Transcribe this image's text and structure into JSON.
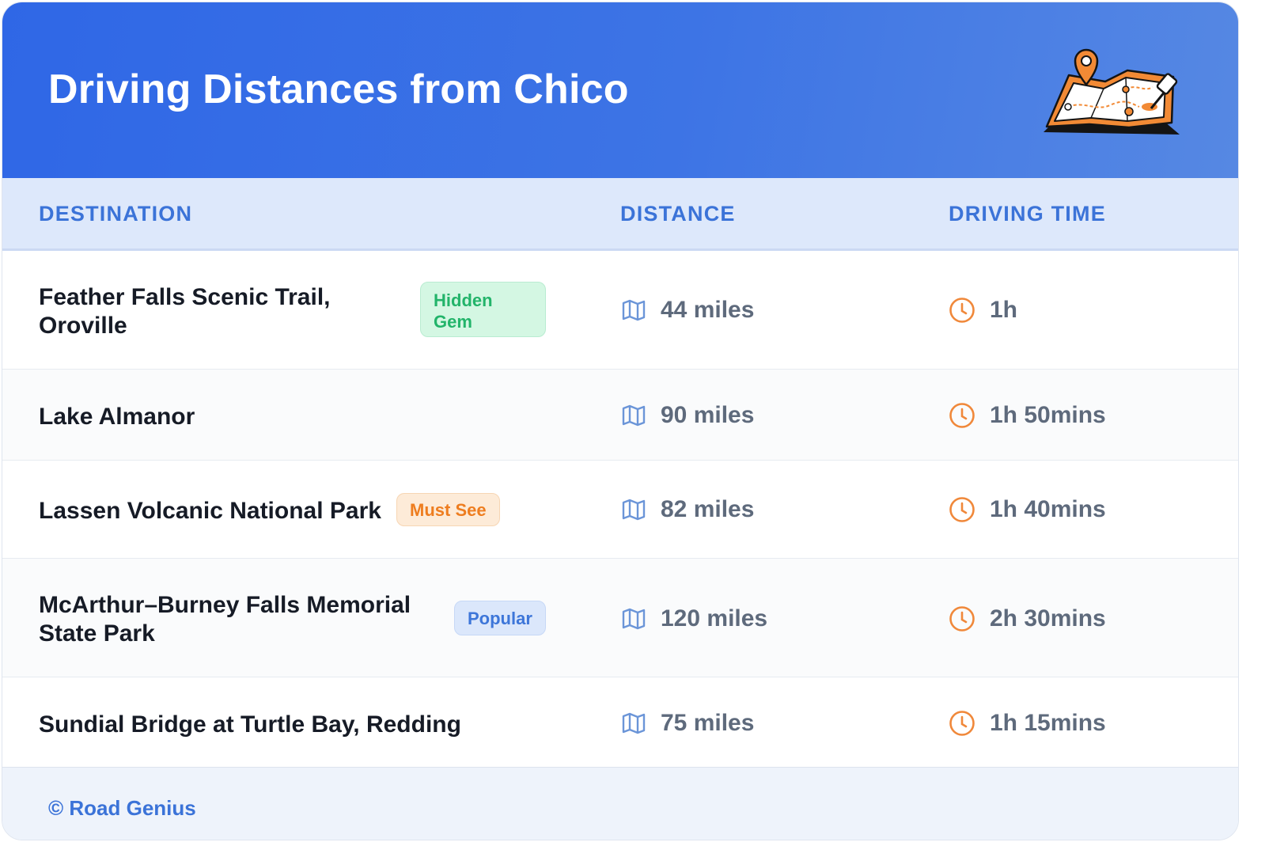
{
  "header": {
    "title": "Driving Distances from Chico"
  },
  "columns": {
    "destination": "DESTINATION",
    "distance": "DISTANCE",
    "driving_time": "DRIVING TIME"
  },
  "icons": {
    "distance": "map-icon",
    "time": "clock-icon"
  },
  "colors": {
    "header_blue": "#2f67e6",
    "accent_blue": "#3b73d8",
    "clock_orange": "#f0883a",
    "hidden_gem_green": "#22b46a",
    "must_see_orange": "#ee7d1f"
  },
  "rows": [
    {
      "destination": "Feather Falls Scenic Trail, Oroville",
      "badge": "Hidden Gem",
      "distance": "44 miles",
      "time": "1h"
    },
    {
      "destination": "Lake Almanor",
      "badge": "",
      "distance": "90 miles",
      "time": "1h 50mins"
    },
    {
      "destination": "Lassen Volcanic National Park",
      "badge": "Must See",
      "distance": "82 miles",
      "time": "1h 40mins"
    },
    {
      "destination": "McArthur–Burney Falls Memorial State Park",
      "badge": "Popular",
      "distance": "120 miles",
      "time": "2h 30mins"
    },
    {
      "destination": "Sundial Bridge at Turtle Bay, Redding",
      "badge": "",
      "distance": "75 miles",
      "time": "1h 15mins"
    }
  ],
  "footer": {
    "credit": "© Road Genius"
  }
}
